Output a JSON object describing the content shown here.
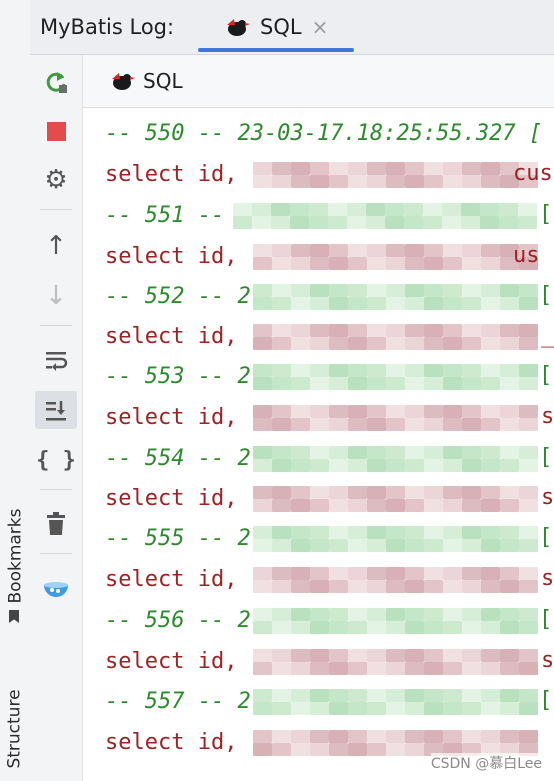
{
  "left_strip": {
    "bookmarks_label": "Bookmarks",
    "structure_label": "Structure"
  },
  "header": {
    "title": "MyBatis Log:",
    "tab_label": "SQL",
    "close_glyph": "×",
    "accent": "#3d78d6"
  },
  "toolbar": {
    "buttons": [
      {
        "name": "rerun-icon",
        "glyph": "⟳"
      },
      {
        "name": "stop-icon",
        "glyph": "■"
      },
      {
        "name": "settings-icon",
        "glyph": "⚙"
      },
      {
        "name": "arrow-up-icon",
        "glyph": "↑"
      },
      {
        "name": "arrow-down-icon",
        "glyph": "↓"
      },
      {
        "name": "soft-wrap-icon",
        "glyph": "⤶"
      },
      {
        "name": "scroll-to-end-icon",
        "glyph": "⇊"
      },
      {
        "name": "braces-icon",
        "glyph": "{ }"
      },
      {
        "name": "trash-icon",
        "glyph": "🗑"
      },
      {
        "name": "bowl-icon",
        "glyph": "◒"
      }
    ]
  },
  "console": {
    "title": "SQL",
    "lines": [
      {
        "type": "comment",
        "text": "-- 550 -- 23-03-17.18:25:55.327 ["
      },
      {
        "type": "sql",
        "text": "select id,"
      },
      {
        "type": "comment",
        "text": "-- 551 --"
      },
      {
        "type": "sql",
        "text": "select id,"
      },
      {
        "type": "comment",
        "text": "-- 552 -- 2"
      },
      {
        "type": "sql",
        "text": "select id,"
      },
      {
        "type": "comment",
        "text": "-- 553 -- 2"
      },
      {
        "type": "sql",
        "text": "select id,"
      },
      {
        "type": "comment",
        "text": "-- 554 -- 2"
      },
      {
        "type": "sql",
        "text": "select id,"
      },
      {
        "type": "comment",
        "text": "-- 555 -- 2"
      },
      {
        "type": "sql",
        "text": "select id,"
      },
      {
        "type": "comment",
        "text": "-- 556 -- 2"
      },
      {
        "type": "sql",
        "text": "select id,"
      },
      {
        "type": "comment",
        "text": "-- 557 -- 2"
      },
      {
        "type": "sql",
        "text": "select id,"
      }
    ],
    "tails": [
      "",
      "cus",
      "[",
      "us",
      "[",
      "_",
      "[",
      "s",
      "[",
      "s",
      "[",
      "s",
      "[",
      "s",
      "[",
      ""
    ]
  },
  "watermark": "CSDN @慕白Lee"
}
